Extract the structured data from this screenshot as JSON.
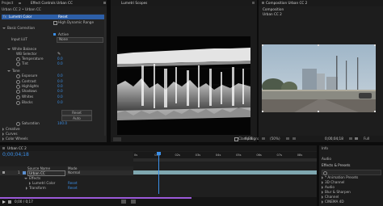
{
  "left": {
    "tab_project": "Project",
    "tab_effect_controls": "Effect Controls Urban CC",
    "breadcrumb": "Urban CC 2 • Urban CC",
    "layer_name": "Lumetri Color",
    "reset": "Reset",
    "hdr_label": "High Dynamic Range",
    "basic_correction": "Basic Correction",
    "active_label": "Active",
    "input_lut": "Input LUT",
    "none": "None",
    "white_balance": "White Balance",
    "wb_selector": "WB Selector",
    "temperature": "Temperature",
    "tint": "Tint",
    "tone": "Tone",
    "exposure": "Exposure",
    "contrast": "Contrast",
    "highlights": "Highlights",
    "shadows": "Shadows",
    "whites": "Whites",
    "blacks": "Blacks",
    "v_temperature": "0.0",
    "v_tint": "0.0",
    "v_exposure": "0.0",
    "v_contrast": "0.0",
    "v_highlights": "0.0",
    "v_shadows": "0.0",
    "v_whites": "0.0",
    "v_blacks": "0.0",
    "reset_button": "Reset",
    "auto_button": "Auto",
    "saturation": "Saturation",
    "v_saturation": "100.0",
    "creative": "Creative",
    "curves": "Curves",
    "color_wheels": "Color Wheels"
  },
  "scope": {
    "tab": "Lumetri Scopes",
    "clamp_signal": "Clamp Signal",
    "bit_depth": "8 Bit"
  },
  "comp": {
    "tab": "Composition Urban CC 2",
    "zoom": "(50%)",
    "timecode": "0;00;04;18",
    "resolution": "Full"
  },
  "timeline": {
    "tab": "Urban CC 2",
    "timecode": "0;00;04;18",
    "col_source": "Source Name",
    "col_mode": "Mode",
    "layer_num": "1",
    "layer_name": "Urban CC",
    "mode_value": "Normal",
    "effects_label": "Effects",
    "effect_lumetri": "Lumetri Color",
    "transform_label": "Transform",
    "reset_1": "Reset",
    "reset_2": "Reset",
    "ruler": [
      "0s",
      "01s",
      "02s",
      "03s",
      "04s",
      "05s",
      "06s",
      "07s",
      "08s"
    ],
    "playbar_time": "0;00 / 0;17"
  },
  "effects": {
    "info_tab": "Info",
    "audio_tab": "Audio",
    "panel_title": "Effects & Presets",
    "items": [
      "* Animation Presets",
      "3D Channel",
      "Audio",
      "Blur & Sharpen",
      "Channel",
      "CINEMA 4D"
    ]
  },
  "colors": {
    "accent": "#3b8fe8",
    "panel": "#232323",
    "purple_bar": "#9b59d9"
  }
}
